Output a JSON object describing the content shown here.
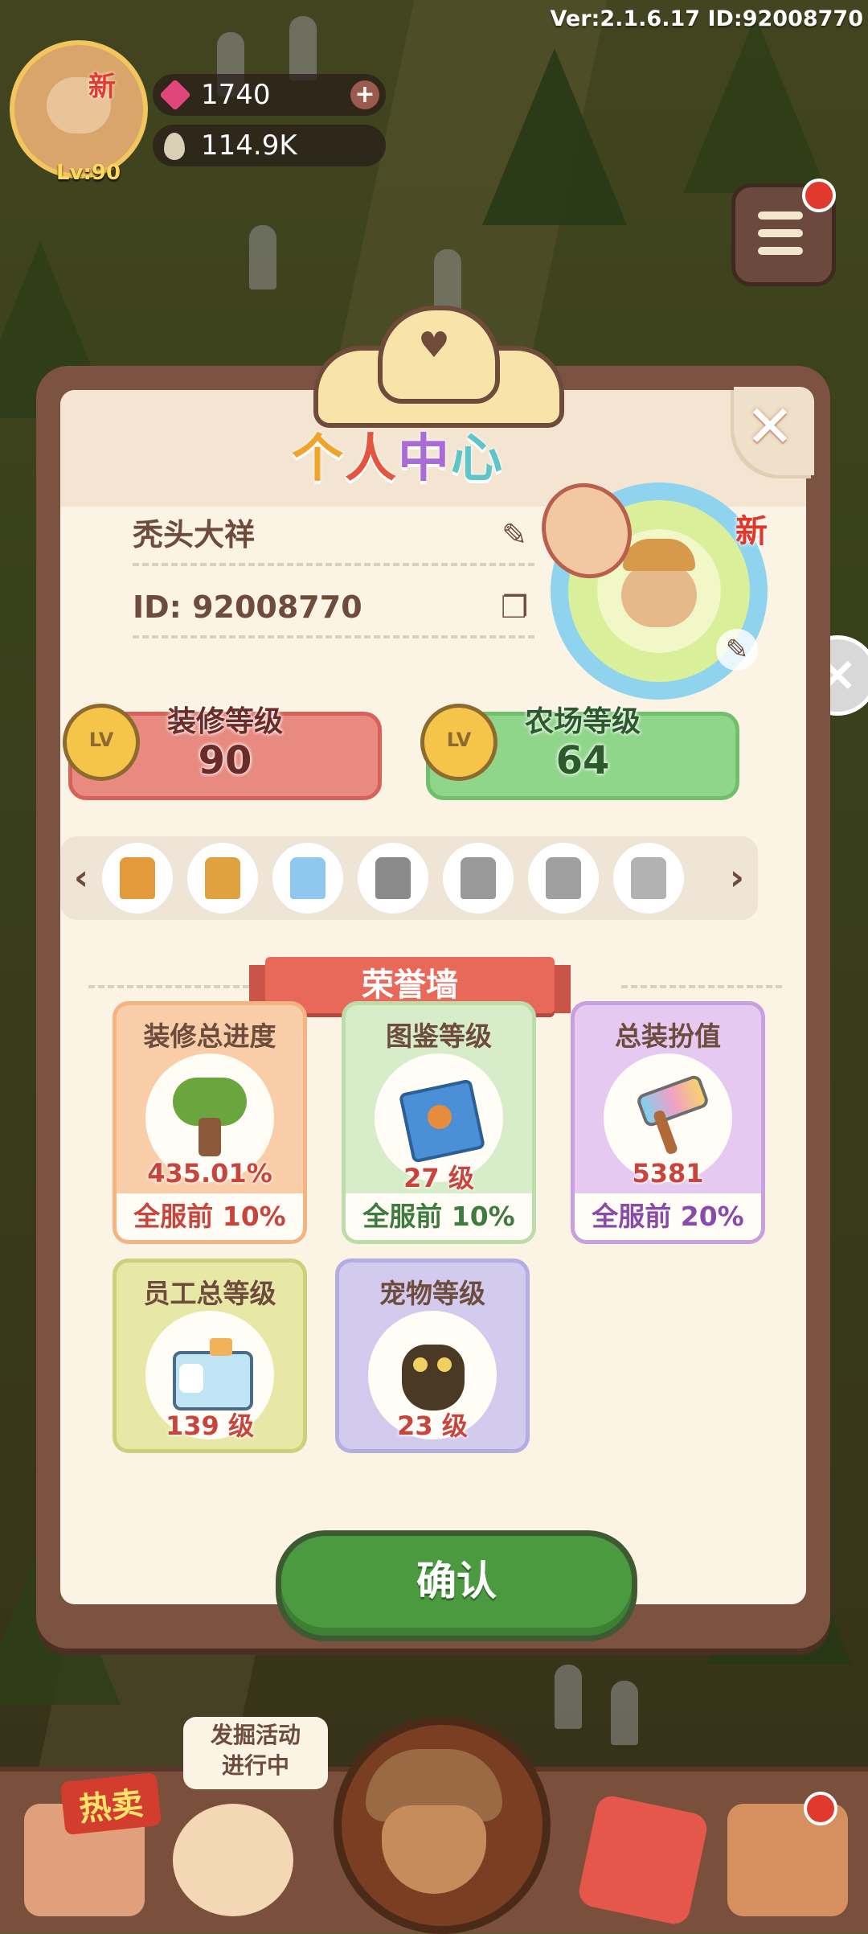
{
  "header": {
    "version": "Ver:2.1.6.17 ID:92008770",
    "avatar_badge": "新",
    "level": "Lv:90",
    "gems": "1740",
    "seeds": "114.9K"
  },
  "modal": {
    "title_chars": [
      "个",
      "人",
      "中",
      "心"
    ],
    "title_colors": [
      "#f0a42c",
      "#e4553f",
      "#a96bd6",
      "#5ec5c9"
    ],
    "nickname": "秃头大祥",
    "id_text": "ID: 92008770",
    "avatar_badge": "新",
    "decor_level": {
      "label": "装修等级",
      "value": "90",
      "badge": "LV"
    },
    "farm_level": {
      "label": "农场等级",
      "value": "64",
      "badge": "LV"
    },
    "trophies": [
      {
        "name": "golden-tree-trophy",
        "color": "#e39a3a"
      },
      {
        "name": "golden-arch-trophy",
        "color": "#e0a23e"
      },
      {
        "name": "star-trophy",
        "color": "#8ec7f0"
      },
      {
        "name": "silver-anvil-trophy",
        "color": "#8a8a8a"
      },
      {
        "name": "silver-mouse-trophy",
        "color": "#9a9a9a"
      },
      {
        "name": "silver-teapot-trophy",
        "color": "#a0a0a0"
      },
      {
        "name": "silver-medal-trophy",
        "color": "#b2b2b2"
      }
    ],
    "honor_wall": "荣誉墙",
    "cards": [
      {
        "title": "装修总进度",
        "value": "435.01%",
        "rank": "全服前 10%",
        "icon": "tree-icon"
      },
      {
        "title": "图鉴等级",
        "value": "27 级",
        "rank": "全服前 10%",
        "icon": "book-icon"
      },
      {
        "title": "总装扮值",
        "value": "5381",
        "rank": "全服前 20%",
        "icon": "paint-roller-icon"
      },
      {
        "title": "员工总等级",
        "value": "139 级",
        "icon": "id-card-icon"
      },
      {
        "title": "宠物等级",
        "value": "23 级",
        "icon": "owl-pet-icon"
      }
    ],
    "confirm": "确认"
  },
  "bottom": {
    "hot_label": "热卖",
    "event_line1": "发掘活动",
    "event_line2": "进行中"
  }
}
